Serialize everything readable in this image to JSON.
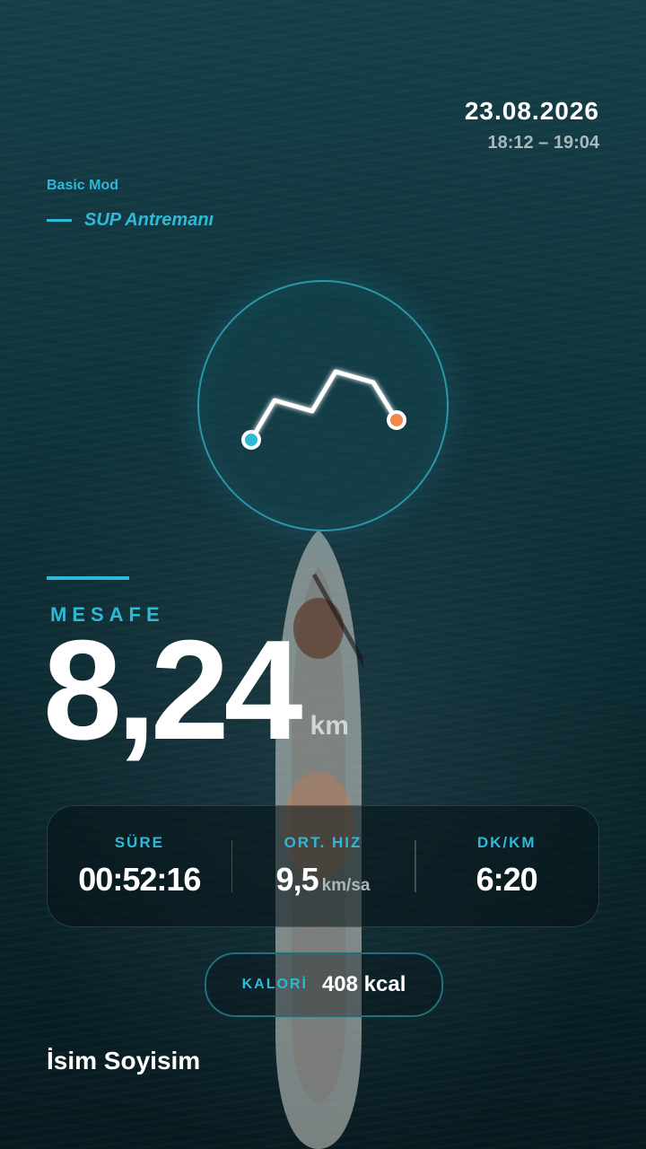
{
  "header": {
    "date": "23.08.2026",
    "time_range": "18:12 – 19:04"
  },
  "workout": {
    "mode": "Basic Mod",
    "activity": "SUP Antremanı"
  },
  "route": {
    "start_color": "#2fb9d8",
    "end_color": "#f08a4b"
  },
  "distance": {
    "label": "MESAFE",
    "value": "8,24",
    "unit": "km"
  },
  "stats": [
    {
      "label": "SÜRE",
      "value": "00:52:16",
      "unit": ""
    },
    {
      "label": "ORT. HIZ",
      "value": "9,5",
      "unit": "km/sa"
    },
    {
      "label": "DK/KM",
      "value": "6:20",
      "unit": ""
    }
  ],
  "calories": {
    "label": "KALORİ",
    "value": "408 kcal"
  },
  "user": {
    "name": "İsim Soyisim"
  },
  "colors": {
    "accent": "#2fb9d8",
    "background": "#0f3038"
  }
}
